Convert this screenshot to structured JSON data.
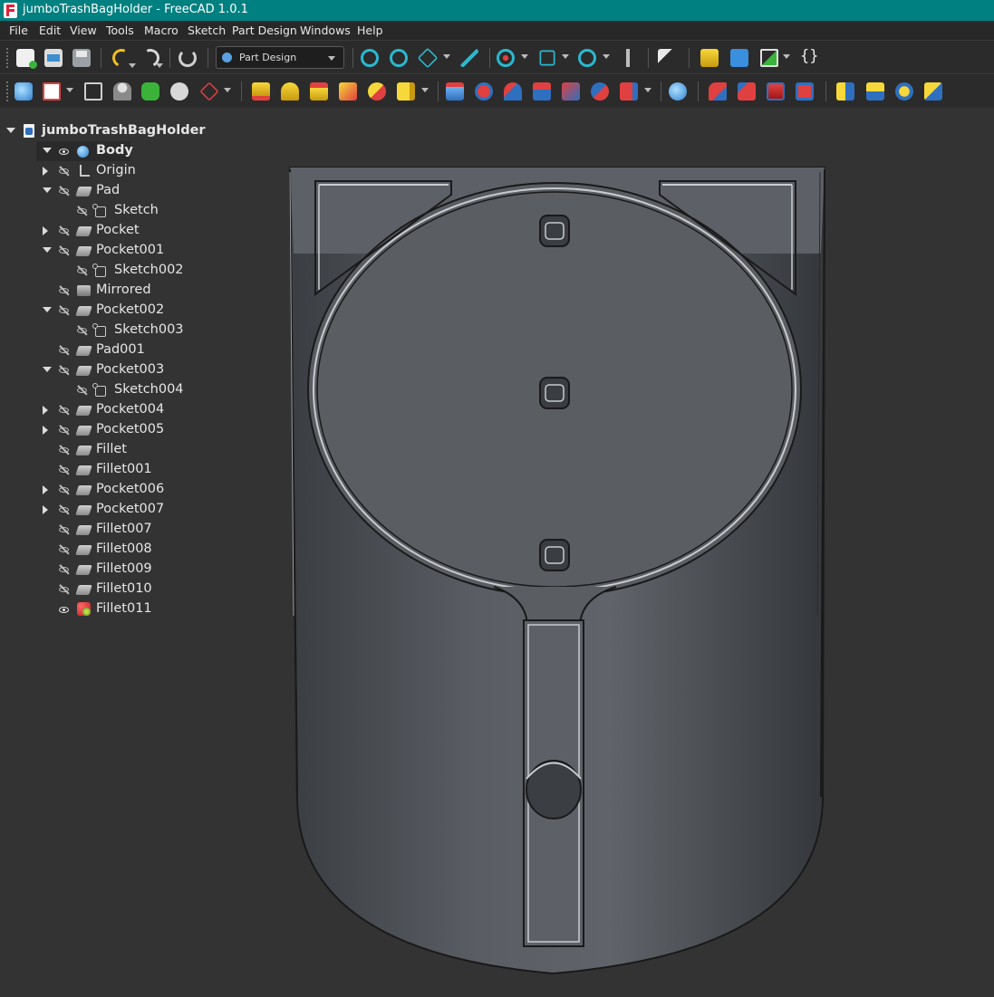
{
  "window": {
    "title": "jumboTrashBagHolder - FreeCAD 1.0.1"
  },
  "menu": [
    "File",
    "Edit",
    "View",
    "Tools",
    "Macro",
    "Sketch",
    "Part Design",
    "Windows",
    "Help"
  ],
  "workbench": {
    "selected": "Part Design"
  },
  "toolbar": {
    "braces_label": "{}"
  },
  "tree": {
    "document": "jumboTrashBagHolder",
    "items": [
      {
        "label": "Body",
        "icon": "body-icon",
        "visible": true,
        "expand": "down",
        "indent": 1,
        "bold": true
      },
      {
        "label": "Origin",
        "icon": "origin-icon",
        "visible": false,
        "expand": "right",
        "indent": 2
      },
      {
        "label": "Pad",
        "icon": "pad-icon",
        "visible": false,
        "expand": "down",
        "indent": 2
      },
      {
        "label": "Sketch",
        "icon": "sketch-icon",
        "visible": false,
        "expand": "none",
        "indent": 3
      },
      {
        "label": "Pocket",
        "icon": "pocket-icon",
        "visible": false,
        "expand": "right",
        "indent": 2
      },
      {
        "label": "Pocket001",
        "icon": "pocket-icon",
        "visible": false,
        "expand": "down",
        "indent": 2
      },
      {
        "label": "Sketch002",
        "icon": "sketch-icon",
        "visible": false,
        "expand": "none",
        "indent": 3
      },
      {
        "label": "Mirrored",
        "icon": "mirrored-icon",
        "visible": false,
        "expand": "none",
        "indent": 2
      },
      {
        "label": "Pocket002",
        "icon": "pocket-icon",
        "visible": false,
        "expand": "down",
        "indent": 2
      },
      {
        "label": "Sketch003",
        "icon": "sketch-icon",
        "visible": false,
        "expand": "none",
        "indent": 3
      },
      {
        "label": "Pad001",
        "icon": "pad-icon",
        "visible": false,
        "expand": "none",
        "indent": 2
      },
      {
        "label": "Pocket003",
        "icon": "pocket-icon",
        "visible": false,
        "expand": "down",
        "indent": 2
      },
      {
        "label": "Sketch004",
        "icon": "sketch-icon",
        "visible": false,
        "expand": "none",
        "indent": 3
      },
      {
        "label": "Pocket004",
        "icon": "pocket-icon",
        "visible": false,
        "expand": "right",
        "indent": 2
      },
      {
        "label": "Pocket005",
        "icon": "pocket-icon",
        "visible": false,
        "expand": "right",
        "indent": 2
      },
      {
        "label": "Fillet",
        "icon": "fillet-icon",
        "visible": false,
        "expand": "none",
        "indent": 2
      },
      {
        "label": "Fillet001",
        "icon": "fillet-icon",
        "visible": false,
        "expand": "none",
        "indent": 2
      },
      {
        "label": "Pocket006",
        "icon": "pocket-icon",
        "visible": false,
        "expand": "right",
        "indent": 2
      },
      {
        "label": "Pocket007",
        "icon": "pocket-icon",
        "visible": false,
        "expand": "right",
        "indent": 2
      },
      {
        "label": "Fillet007",
        "icon": "fillet-icon",
        "visible": false,
        "expand": "none",
        "indent": 2
      },
      {
        "label": "Fillet008",
        "icon": "fillet-icon",
        "visible": false,
        "expand": "none",
        "indent": 2
      },
      {
        "label": "Fillet009",
        "icon": "fillet-icon",
        "visible": false,
        "expand": "none",
        "indent": 2
      },
      {
        "label": "Fillet010",
        "icon": "fillet-icon",
        "visible": false,
        "expand": "none",
        "indent": 2
      },
      {
        "label": "Fillet011",
        "icon": "tip-fillet-icon",
        "visible": true,
        "expand": "none",
        "indent": 2
      }
    ]
  },
  "colors": {
    "titlebar": "#008080",
    "background": "#333333",
    "model": "#5d6167"
  }
}
